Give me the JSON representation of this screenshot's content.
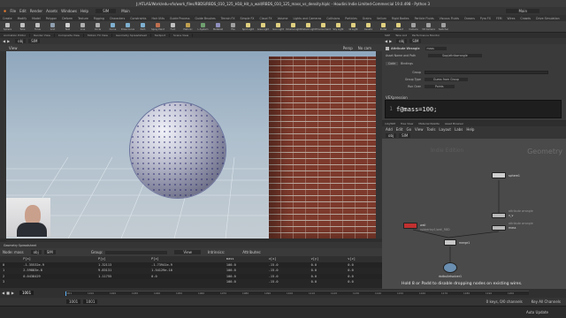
{
  "window": {
    "title": "J:/ATLAS/Work/edu-vfx/work_files/RBDS/RBDS_010_125_H18_Hit_a_wall/RBDS_010_125_mass_vs_density.hiplc - Houdini Indie Limited-Commercial 19.0.498 - Python 3"
  },
  "menu": {
    "items": [
      "File",
      "Edit",
      "Render",
      "Assets",
      "Windows",
      "Help"
    ],
    "desktop": "SIM",
    "main": "Main"
  },
  "shelf": {
    "tabs": [
      "Create",
      "Modify",
      "Model",
      "Polygon",
      "Deform",
      "Texture",
      "Rigging",
      "Characters",
      "Constraints",
      "Hair Utils",
      "Guide Process",
      "Guide Brushes",
      "Terrain FX",
      "Simple FX",
      "Cloud FX",
      "Volume",
      "Lights and Cameras",
      "Collisions",
      "Particles",
      "Grains",
      "Vellum",
      "Rigid Bodies",
      "Particle Fluids",
      "Viscous Fluids",
      "Oceans",
      "Pyro FX",
      "FEM",
      "Wires",
      "Crowds",
      "Drive Simulation"
    ],
    "tools": [
      "Sphere",
      "Tube",
      "Torus",
      "Grid",
      "Null",
      "Line",
      "Circle",
      "Curve",
      "Draw Curve",
      "Path",
      "Spray Paint",
      "Font",
      "Platonic",
      "L-System",
      "Metaball",
      "File",
      "Spot Light",
      "Area Light",
      "Geo Light",
      "Volume Light",
      "Distant Light",
      "Environment",
      "Sky Light",
      "GI Light",
      "Caustic",
      "Portal",
      "Ambient",
      "Camera",
      "VR Camera",
      "Switcher"
    ],
    "tool_colors": [
      "#c0c0c0",
      "#c0c0c0",
      "#c0c0c0",
      "#8fa0b0",
      "#d0d0d0",
      "#b0b0b0",
      "#b0b0b0",
      "#7fb0d0",
      "#7fb0d0",
      "#7fb0d0",
      "#c07050",
      "#c0c0c0",
      "#c0a050",
      "#70a070",
      "#9090c0",
      "#a0a0a0",
      "#e0d080",
      "#e0d080",
      "#e0d080",
      "#e0d080",
      "#e0d080",
      "#e0d080",
      "#e0d080",
      "#e0d080",
      "#e0d080",
      "#e0d080",
      "#e0d080",
      "#a0a0a0",
      "#a0a0a0",
      "#a0a0a0"
    ]
  },
  "left_tabs": [
    "Animation Editor",
    "Render View",
    "Composite View",
    "Motion FX View",
    "Geometry Spreadsheet",
    "Textport",
    "Scene View"
  ],
  "left_path": {
    "obj": "obj",
    "node": "SIM"
  },
  "viewport": {
    "title": "View",
    "camera": "Persp",
    "cam_label": "No cam"
  },
  "spreadsheet": {
    "tab": "Geometry Spreadsheet",
    "path_obj": "obj",
    "path_node": "SIM",
    "node_label": "Node: mass",
    "group_label": "Group:",
    "view_label": "View",
    "intrinsics": "Intrinsics:",
    "attributes": "Attributes:",
    "columns": [
      "",
      "P[x]",
      "P[y]",
      "P[z]",
      "mass",
      "v[x]",
      "v[y]",
      "v[z]"
    ],
    "rows": [
      [
        "0",
        "-1.35532e-9",
        "1.32113",
        "-1.73941e-9",
        "100.0",
        "-15.0",
        "0.0",
        "0.0"
      ],
      [
        "1",
        "2.59883e-8",
        "9.83131",
        "1.54129e-10",
        "100.0",
        "-15.0",
        "0.0",
        "0.0"
      ],
      [
        "2",
        "0.0438429",
        "1.11755",
        "0.0",
        "100.0",
        "-15.0",
        "0.0",
        "0.0"
      ],
      [
        "3",
        "",
        "",
        "",
        "100.0",
        "-15.0",
        "0.0",
        "0.0"
      ]
    ]
  },
  "timeline": {
    "current_frame": "1001",
    "start": "1001",
    "end": "1001",
    "ticks": [
      "1001",
      "1010",
      "1020",
      "1030",
      "1040",
      "1050",
      "1060",
      "1070",
      "1080",
      "1090",
      "1100",
      "1110",
      "1120",
      "1130",
      "1140",
      "1150",
      "1160",
      "1170",
      "1180",
      "1190",
      "1200"
    ]
  },
  "status": {
    "keys": "0 keys, 0/0 channels",
    "key_all": "Key All Channels",
    "auto_update": "Auto Update"
  },
  "right": {
    "tabs": [
      "SOP",
      "Take List",
      "Performance Monitor"
    ],
    "path_obj": "obj",
    "path_node": "SIM",
    "node_type": "Attribute Wrangle",
    "node_name": "mass",
    "asset_name": "Asset Name and Path",
    "asset_value": "Sop/attribwrangle",
    "code_tab": "Code",
    "bindings_tab": "Bindings",
    "group_label": "Group",
    "group_type_label": "Group Type",
    "group_type": "Guess from Group",
    "run_over_label": "Run Over",
    "run_over": "Points",
    "vexpr_label": "VEXpression",
    "code_line_no": "1",
    "code": "f@mass=100;"
  },
  "network": {
    "tabs": [
      "/obj/SIM",
      "Tree View",
      "Material Palette",
      "Asset Browser"
    ],
    "menu": [
      "Add",
      "Edit",
      "Go",
      "View",
      "Tools",
      "Layout",
      "Labs",
      "Help"
    ],
    "path_obj": "obj",
    "path_node": "SIM",
    "context": "Geometry",
    "watermark": "Indie Edition",
    "nodes": {
      "sphere": "sphere1",
      "wrangle_type": "attribute wrangle",
      "mass": "mass",
      "vel": "v_v",
      "wall": "wall",
      "wall_sub": "rubbertoy1/wall_RBD",
      "merge": "merge1",
      "solver": "rbdbulletsolver1"
    },
    "hint": "Hold 8 or Padd to disable dropping nodes on existing wires."
  }
}
